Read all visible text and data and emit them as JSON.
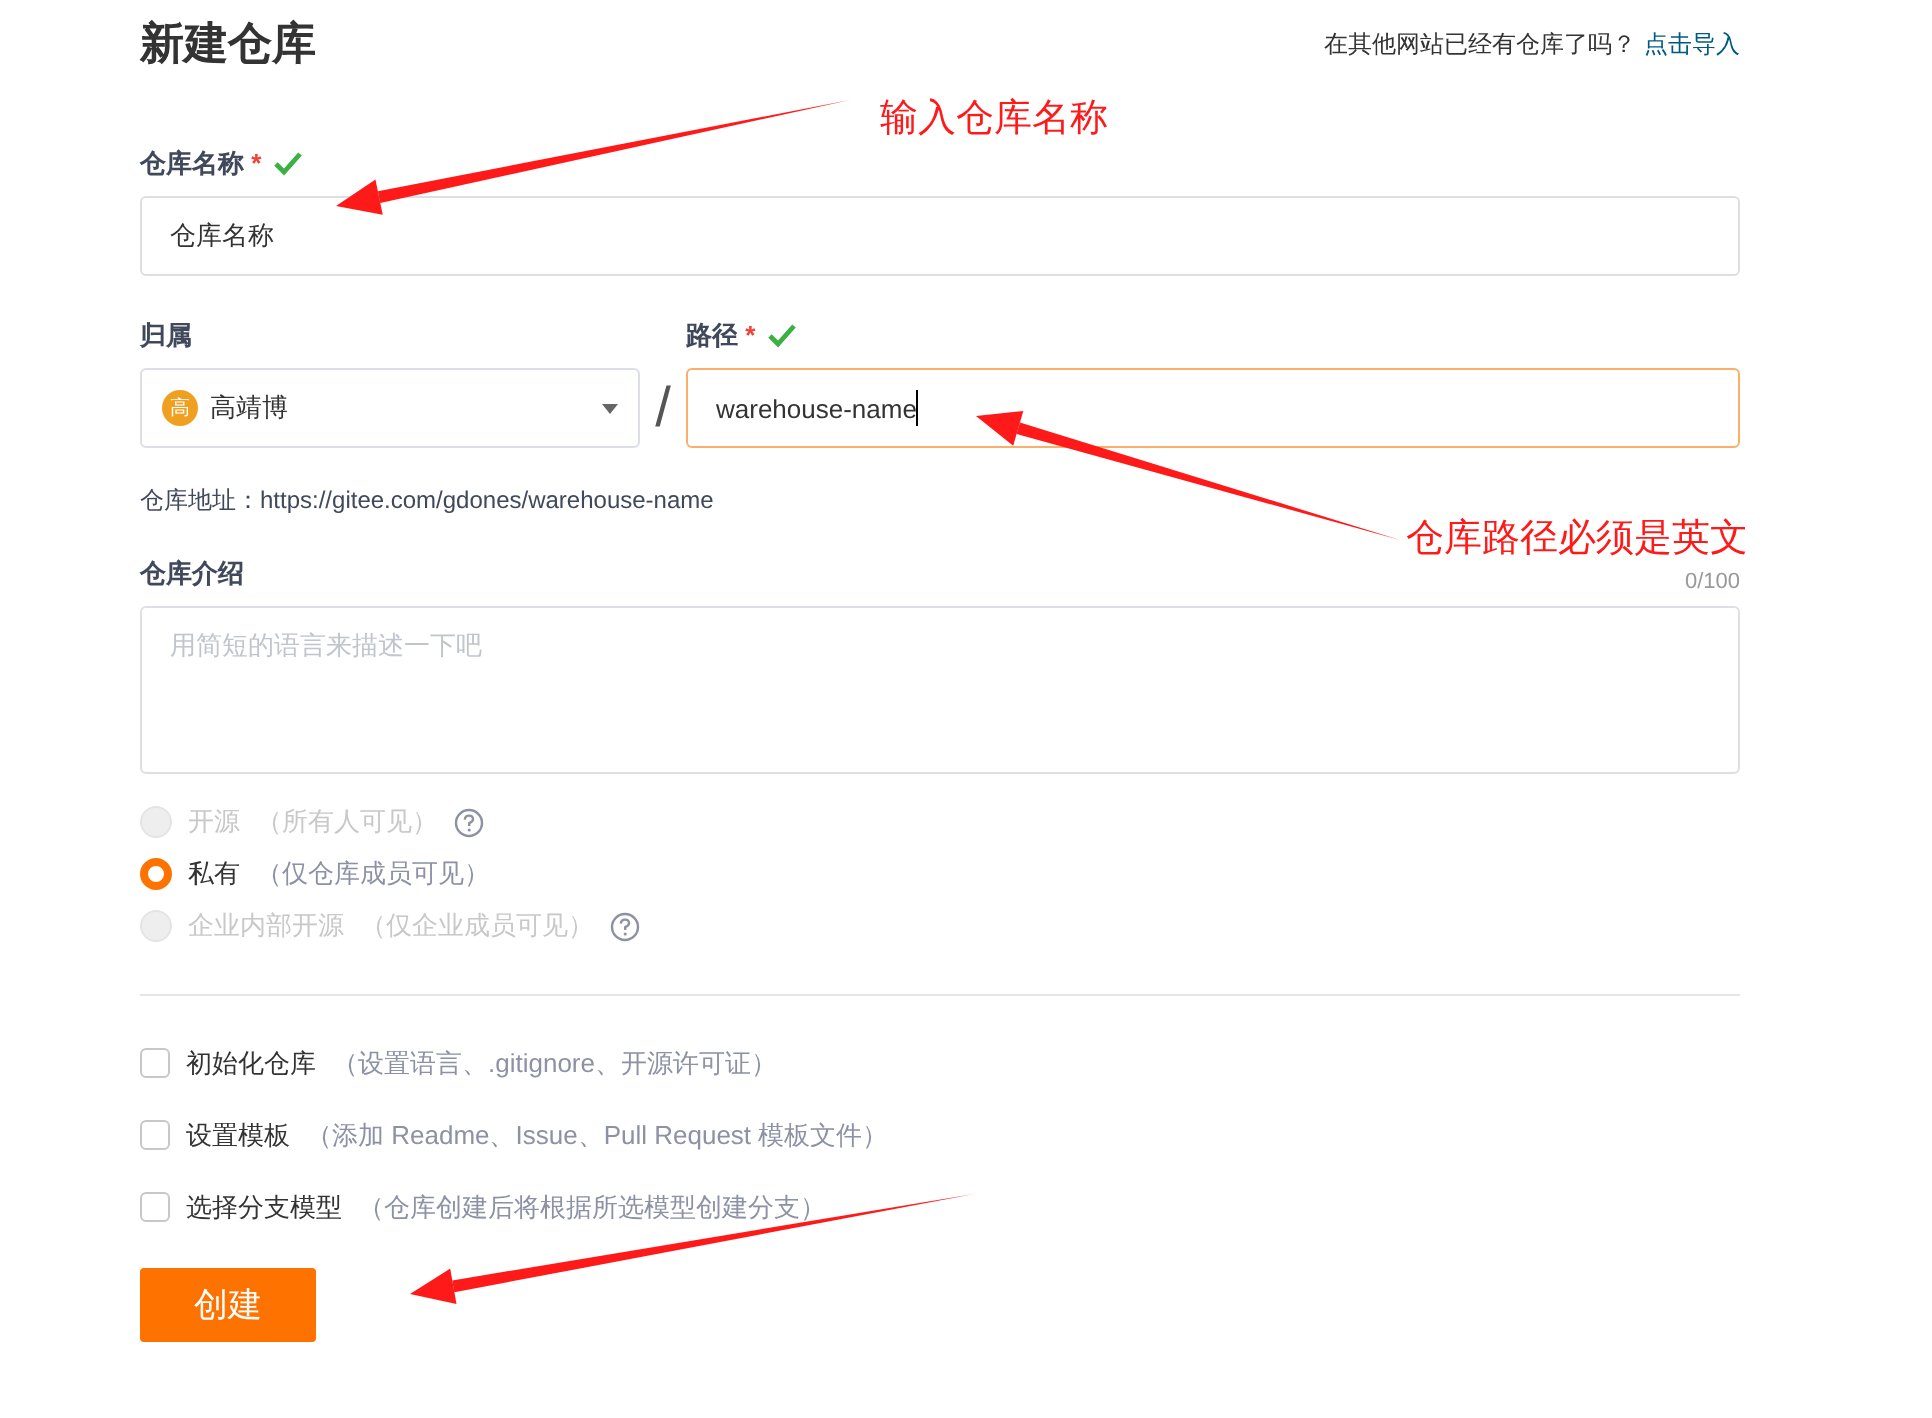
{
  "page": {
    "title": "新建仓库",
    "import_prompt": "在其他网站已经有仓库了吗？",
    "import_link": "点击导入"
  },
  "name_field": {
    "label": "仓库名称",
    "required_mark": "*",
    "valid": true,
    "value": "仓库名称"
  },
  "owner_field": {
    "label": "归属",
    "avatar_text": "高",
    "value": "高靖博"
  },
  "separator": "/",
  "path_field": {
    "label": "路径",
    "required_mark": "*",
    "valid": true,
    "value": "warehouse-name",
    "focused": true
  },
  "address": "仓库地址：https://gitee.com/gdones/warehouse-name",
  "description_field": {
    "label": "仓库介绍",
    "counter": "0/100",
    "placeholder": "用简短的语言来描述一下吧"
  },
  "visibility": [
    {
      "label": "开源",
      "hint": "（所有人可见）",
      "selected": false,
      "disabled": true,
      "help": true
    },
    {
      "label": "私有",
      "hint": "（仅仓库成员可见）",
      "selected": true,
      "disabled": false,
      "help": false
    },
    {
      "label": "企业内部开源",
      "hint": "（仅企业成员可见）",
      "selected": false,
      "disabled": true,
      "help": true
    }
  ],
  "options": [
    {
      "label": "初始化仓库",
      "hint": "（设置语言、.gitignore、开源许可证）",
      "checked": false
    },
    {
      "label": "设置模板",
      "hint": "（添加 Readme、Issue、Pull Request 模板文件）",
      "checked": false
    },
    {
      "label": "选择分支模型",
      "hint": "（仓库创建后将根据所选模型创建分支）",
      "checked": false
    }
  ],
  "submit_button": "创建",
  "annotations": [
    {
      "text": "输入仓库名称"
    },
    {
      "text": "仓库路径必须是英文"
    }
  ]
}
